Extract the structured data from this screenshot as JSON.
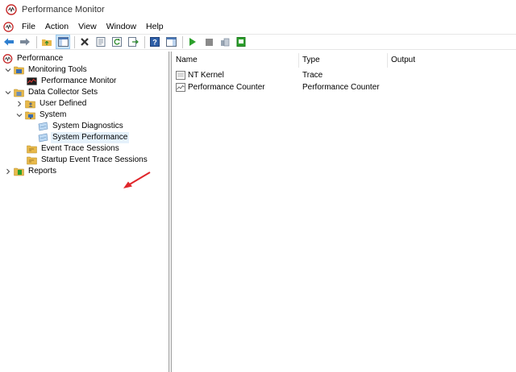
{
  "window": {
    "title": "Performance Monitor",
    "icon": "performance-monitor-icon"
  },
  "menu": {
    "items": [
      "File",
      "Action",
      "View",
      "Window",
      "Help"
    ]
  },
  "toolbar": {
    "buttons": [
      "back-arrow-icon",
      "forward-arrow-icon",
      "folder-up-icon",
      "show-hide-tree-icon",
      "delete-icon",
      "properties-icon",
      "refresh-icon",
      "export-list-icon",
      "help-icon",
      "show-hide-action-pane-icon",
      "start-icon",
      "stop-icon",
      "new-collector-set-icon",
      "latest-report-icon"
    ]
  },
  "tree": {
    "root": "Performance",
    "monitoring_tools": "Monitoring Tools",
    "performance_monitor": "Performance Monitor",
    "data_collector_sets": "Data Collector Sets",
    "user_defined": "User Defined",
    "system": "System",
    "system_diagnostics": "System Diagnostics",
    "system_performance": "System Performance",
    "event_trace_sessions": "Event Trace Sessions",
    "startup_event_trace_sessions": "Startup Event Trace Sessions",
    "reports": "Reports"
  },
  "list": {
    "columns": [
      "Name",
      "Type",
      "Output"
    ],
    "rows": [
      {
        "name": "NT Kernel",
        "type": "Trace",
        "output": ""
      },
      {
        "name": "Performance Counter",
        "type": "Performance Counter",
        "output": ""
      }
    ]
  },
  "colors": {
    "selection": "#e5f1fb",
    "accent_green": "#2ca02c",
    "annotation_arrow": "#e0262b"
  }
}
